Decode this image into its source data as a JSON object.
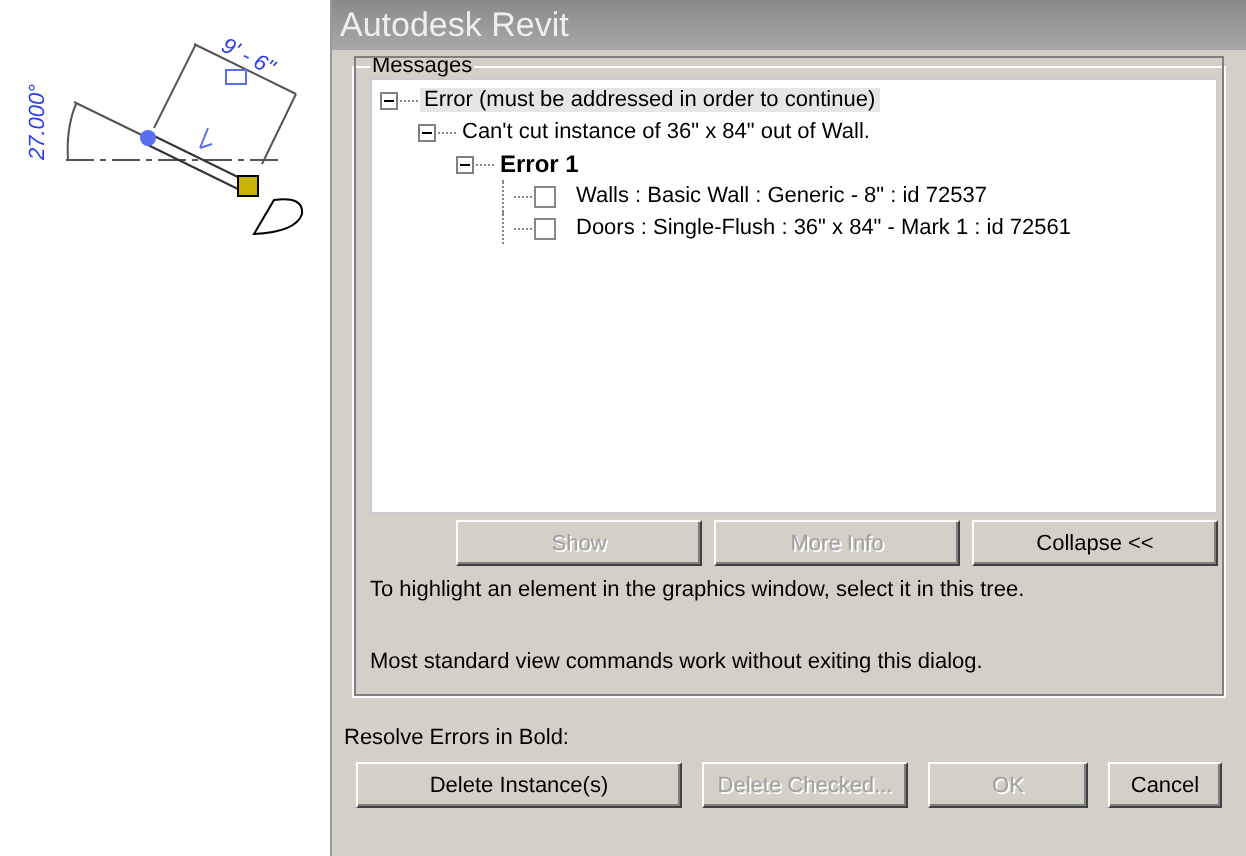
{
  "canvas": {
    "angle_dimension": "27.000°",
    "length_dimension": "9' - 6\""
  },
  "window": {
    "title": "Autodesk Revit"
  },
  "messages": {
    "label": "Messages",
    "tree": [
      {
        "kind": "group",
        "label": "Error (must be addressed in order to continue)",
        "selected": true,
        "expanded": true,
        "children": [
          {
            "kind": "group",
            "label": "Can't cut instance of 36\" x 84\" out of Wall.",
            "selected": false,
            "expanded": true,
            "children": [
              {
                "kind": "error",
                "label": "Error 1",
                "selected": false,
                "expanded": true,
                "children": [
                  {
                    "kind": "element",
                    "label": "Walls : Basic Wall : Generic - 8\" : id 72537",
                    "selected": false,
                    "checked": false
                  },
                  {
                    "kind": "element",
                    "label": "Doors : Single-Flush : 36\" x 84\" - Mark 1 : id 72561",
                    "selected": false,
                    "checked": false
                  }
                ]
              }
            ]
          }
        ]
      }
    ],
    "buttons": [
      {
        "label": "Show",
        "disabled": true
      },
      {
        "label": "More Info",
        "disabled": true
      },
      {
        "label": "Collapse <<",
        "disabled": false
      }
    ],
    "notes": [
      "To highlight an element in the graphics window, select it in this tree.",
      "Most standard view commands work without exiting this dialog."
    ]
  },
  "resolve_label": "Resolve Errors in Bold:",
  "buttons": [
    {
      "label": "Delete Instance(s)",
      "disabled": false
    },
    {
      "label": "Delete Checked...",
      "disabled": true
    },
    {
      "label": "OK",
      "disabled": true
    },
    {
      "label": "Cancel",
      "disabled": false
    }
  ]
}
